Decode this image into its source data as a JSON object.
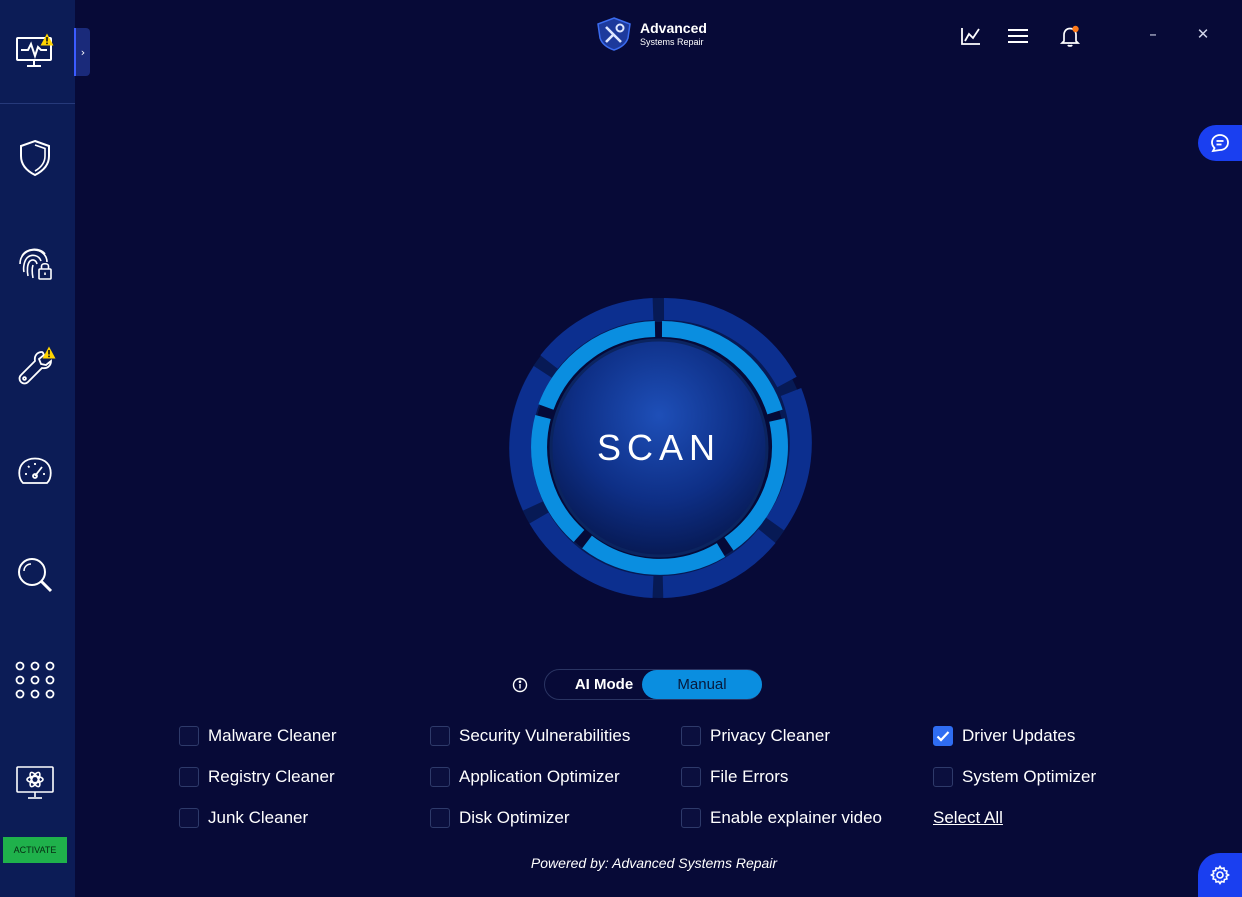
{
  "app": {
    "brand_line1": "Advanced",
    "brand_line2": "Systems Repair"
  },
  "sidebar": {
    "items": [
      {
        "icon": "monitor-pulse-icon",
        "warning": true
      },
      {
        "icon": "shield-icon",
        "warning": false
      },
      {
        "icon": "fingerprint-lock-icon",
        "warning": false
      },
      {
        "icon": "wrench-icon",
        "warning": true
      },
      {
        "icon": "speedometer-icon",
        "warning": false
      },
      {
        "icon": "magnifier-icon",
        "warning": false
      },
      {
        "icon": "apps-grid-icon",
        "warning": false
      },
      {
        "icon": "monitor-atom-icon",
        "warning": false
      }
    ],
    "expand_glyph": "›",
    "activate_label": "ACTIVATE"
  },
  "header": {
    "icons": [
      "chart-icon",
      "menu-icon",
      "bell-icon"
    ],
    "notification_dot": true,
    "minimize_glyph": "–",
    "close_glyph": "✕"
  },
  "scan": {
    "label": "SCAN"
  },
  "mode": {
    "ai_label": "AI Mode",
    "manual_label": "Manual",
    "selected": "Manual"
  },
  "options": [
    {
      "label": "Malware Cleaner",
      "checked": false
    },
    {
      "label": "Security Vulnerabilities",
      "checked": false
    },
    {
      "label": "Privacy Cleaner",
      "checked": false
    },
    {
      "label": "Driver Updates",
      "checked": true
    },
    {
      "label": "Registry Cleaner",
      "checked": false
    },
    {
      "label": "Application Optimizer",
      "checked": false
    },
    {
      "label": "File Errors",
      "checked": false
    },
    {
      "label": "System Optimizer",
      "checked": false
    },
    {
      "label": "Junk Cleaner",
      "checked": false
    },
    {
      "label": "Disk Optimizer",
      "checked": false
    },
    {
      "label": "Enable explainer video",
      "checked": false
    }
  ],
  "select_all_label": "Select All",
  "footer": {
    "powered_by": "Powered by: Advanced Systems Repair"
  },
  "colors": {
    "background": "#070a37",
    "sidebar": "#0c1c56",
    "accent": "#0a8ee0",
    "checkbox_checked": "#2f6df2",
    "activate": "#1fb14b",
    "warning": "#ffd400",
    "notification": "#ff7a1a"
  }
}
